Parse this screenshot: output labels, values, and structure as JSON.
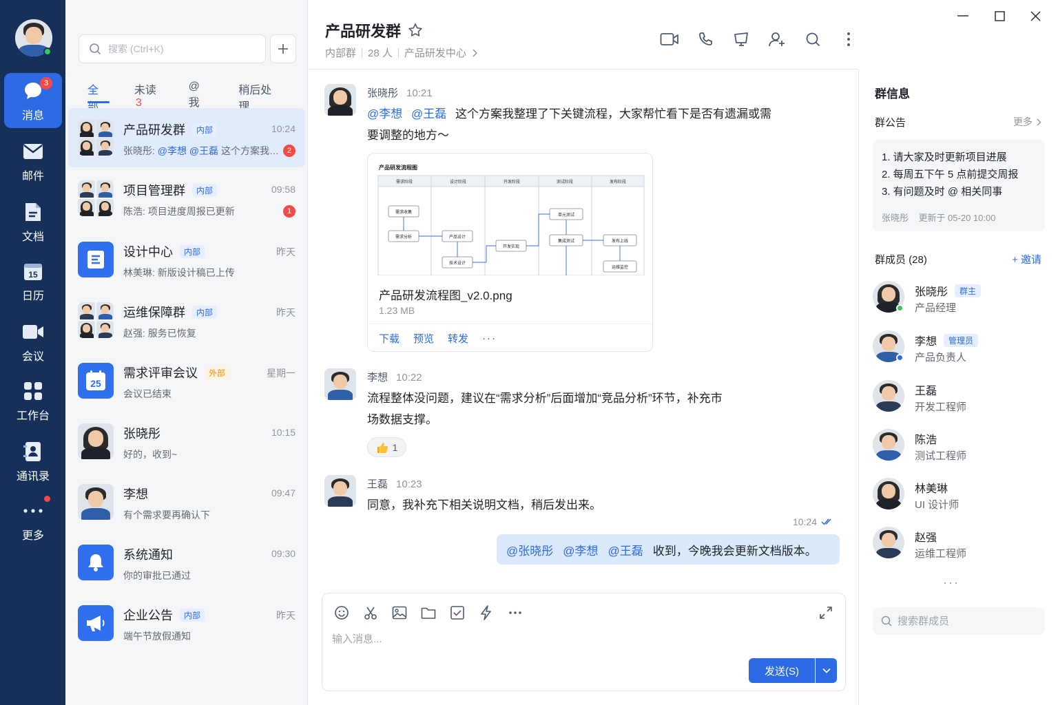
{
  "rail": {
    "items": [
      {
        "label": "消息",
        "icon": "chat-bubble-icon",
        "badge": "3",
        "active": true
      },
      {
        "label": "邮件",
        "icon": "mail-icon"
      },
      {
        "label": "文档",
        "icon": "document-icon"
      },
      {
        "label": "日历",
        "icon": "calendar-icon",
        "glyph": "15"
      },
      {
        "label": "会议",
        "icon": "video-icon"
      },
      {
        "label": "工作台",
        "icon": "apps-grid-icon"
      },
      {
        "label": "通讯录",
        "icon": "contacts-icon"
      },
      {
        "label": "更多",
        "icon": "more-dots-icon",
        "dot": true
      }
    ]
  },
  "list": {
    "search_placeholder": "搜索 (Ctrl+K)",
    "tabs": [
      {
        "label": "全部",
        "active": true
      },
      {
        "label": "未读",
        "count": "3"
      },
      {
        "label": "@ 我"
      },
      {
        "label": "稍后处理"
      }
    ],
    "conversations": [
      {
        "name": "产品研发群",
        "tag": "内部",
        "time": "10:24",
        "sender": "张晓彤: ",
        "mentions": "@李想 @王磊",
        "msg": " 这个方案我整理了下关键流程",
        "badge": "2",
        "active": true,
        "avatar": "group"
      },
      {
        "name": "项目管理群",
        "tag": "内部",
        "time": "09:58",
        "sender": "",
        "mentions": "",
        "msg": "陈浩: 项目进度周报已更新",
        "badge": "1",
        "avatar": "group"
      },
      {
        "name": "设计中心",
        "tag": "内部",
        "time": "昨天",
        "sender": "",
        "mentions": "",
        "msg": "林美琳: 新版设计稿已上传",
        "avatar": "design"
      },
      {
        "name": "运维保障群",
        "tag": "内部",
        "time": "昨天",
        "sender": "",
        "mentions": "",
        "msg": "赵强: 服务已恢复",
        "avatar": "group"
      },
      {
        "name": "需求评审会议",
        "tag": "外部",
        "time": "星期一",
        "sender": "",
        "mentions": "",
        "msg": "会议已结束",
        "avatar": "calendar",
        "calendar_day": "25"
      },
      {
        "name": "张晓彤",
        "time": "10:15",
        "sender": "",
        "mentions": "",
        "msg": "好的，收到~",
        "avatar": "person-f"
      },
      {
        "name": "李想",
        "time": "09:47",
        "sender": "",
        "mentions": "",
        "msg": "有个需求要再确认下",
        "avatar": "person-m"
      },
      {
        "name": "系统通知",
        "time": "09:30",
        "sender": "",
        "mentions": "",
        "msg": "你的审批已通过",
        "avatar": "bell"
      },
      {
        "name": "企业公告",
        "tag": "内部",
        "time": "昨天",
        "sender": "",
        "mentions": "",
        "msg": "端午节放假通知",
        "avatar": "megaphone"
      }
    ]
  },
  "chat": {
    "title": "产品研发群",
    "sub_type": "内部群",
    "sub_members": "28 人",
    "sub_dept": "产品研发中心",
    "messages": [
      {
        "sender": "张晓彤",
        "time": "10:21",
        "mention1": "@李想",
        "mention2": "@王磊",
        "text": "这个方案我整理了下关键流程，大家帮忙看下是否有遗漏或需要调整的地方～"
      },
      {
        "sender": "李想",
        "time": "10:22",
        "text": "流程整体没问题，建议在“需求分析”后面增加“竞品分析”环节，补充市场数据支撑。",
        "reaction": "1"
      },
      {
        "sender": "王磊",
        "time": "10:23",
        "text": "同意，我补充下相关说明文档，稍后发出来。"
      }
    ],
    "file": {
      "name": "产品研发流程图_v2.0.png",
      "size": "1.23 MB",
      "actions": [
        "下载",
        "预览",
        "转发",
        "···"
      ],
      "flow_title": "产品研发流程图",
      "flow_columns": [
        "需求阶段",
        "设计阶段",
        "开发阶段",
        "测试阶段",
        "发布阶段"
      ],
      "flow_nodes": [
        "需求收集",
        "需求分析",
        "产品设计",
        "技术设计",
        "开发实现",
        "单元测试",
        "集成测试",
        "发布上线",
        "运维监控"
      ]
    },
    "self": {
      "time": "10:24",
      "mentions": [
        "@张晓彤",
        "@李想",
        "@王磊"
      ],
      "text": "收到，今晚我会更新文档版本。"
    },
    "composer_placeholder": "输入消息...",
    "send_label": "发送(S)"
  },
  "info": {
    "title": "群信息",
    "notice_title": "群公告",
    "notice_more": "更多",
    "notice_lines": [
      "1. 请大家及时更新项目进展",
      "2. 每周五下午 5 点前提交周报",
      "3. 有问题及时 @ 相关同事"
    ],
    "notice_meta": "张晓彤    更新于 05-20 10:00",
    "members_title": "群成员 (28)",
    "invite_label": "+ 邀请",
    "members": [
      {
        "name": "张晓彤",
        "role": "产品经理",
        "tag": "群主",
        "status": "#34c759",
        "gender": "f"
      },
      {
        "name": "李想",
        "role": "产品负责人",
        "tag": "管理员",
        "status": "#2d6be4",
        "gender": "m"
      },
      {
        "name": "王磊",
        "role": "开发工程师",
        "gender": "m"
      },
      {
        "name": "陈浩",
        "role": "测试工程师",
        "gender": "m"
      },
      {
        "name": "林美琳",
        "role": "UI 设计师",
        "gender": "f"
      },
      {
        "name": "赵强",
        "role": "运维工程师",
        "gender": "m"
      }
    ],
    "more_dots": "···",
    "search_placeholder": "搜索群成员"
  },
  "colors": {
    "rail": "#17305a",
    "accent": "#2d6be4",
    "badge": "#f54a45",
    "online": "#34c759"
  }
}
